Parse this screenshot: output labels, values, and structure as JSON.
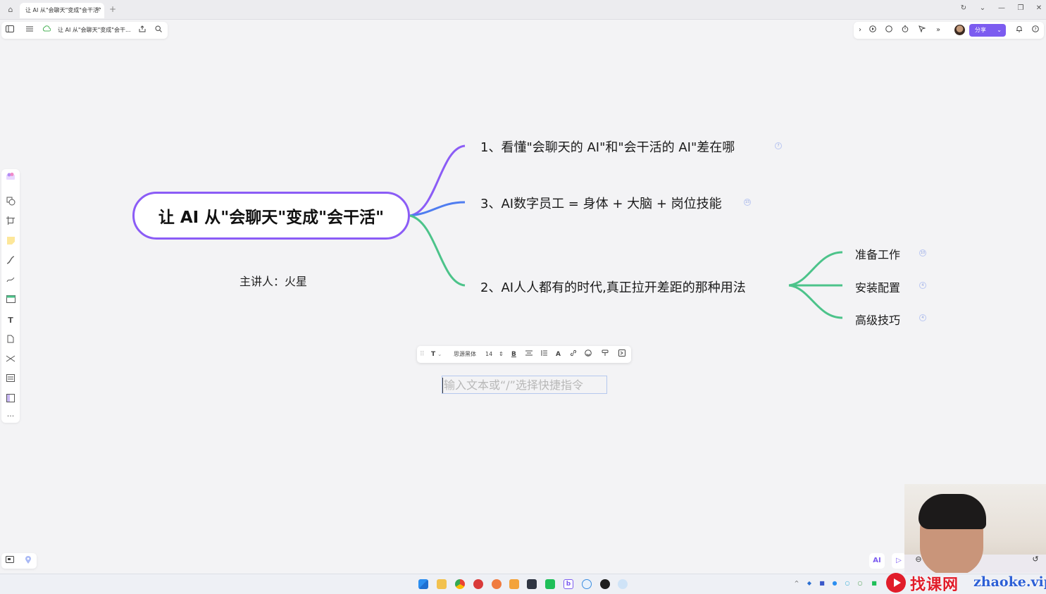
{
  "browser": {
    "tab_title": "让 AI 从\"会聊天\"变成\"会干活\"",
    "tab_close": "×",
    "new_tab": "+",
    "home_icon": "⌂",
    "controls": [
      "↻",
      "⌄",
      "—",
      "❐",
      "✕"
    ]
  },
  "toolbar": {
    "doc_title": "让 AI 从\"会聊天\"变成\"会干...",
    "share_label": "分享"
  },
  "mindmap": {
    "root": "让 AI 从\"会聊天\"变成\"会干活\"",
    "subtitle": "主讲人：火星",
    "colors": {
      "purple": "#8b5cf6",
      "blue": "#4f7df0",
      "green": "#4cc38a"
    },
    "branches": [
      {
        "label": "1、看懂\"会聊天的 AI\"和\"会干活的 AI\"差在哪",
        "badge": "7",
        "color": "#8b5cf6"
      },
      {
        "label": "3、AI数字员工 = 身体 + 大脑 + 岗位技能",
        "badge": "15",
        "color": "#4f7df0"
      },
      {
        "label": "2、AI人人都有的时代,真正拉开差距的那种用法",
        "badge": "",
        "color": "#4cc38a"
      }
    ],
    "leaves": [
      {
        "label": "准备工作",
        "badge": "10"
      },
      {
        "label": "安装配置",
        "badge": "4"
      },
      {
        "label": "高级技巧",
        "badge": "4"
      }
    ]
  },
  "text_toolbar": {
    "type_label": "T",
    "font_name": "思源黑体",
    "font_size": "14"
  },
  "text_input": {
    "placeholder": "输入文本或“/”选择快捷指令"
  },
  "watermark": {
    "cn": "找课网",
    "url": "zhaoke.vip"
  }
}
